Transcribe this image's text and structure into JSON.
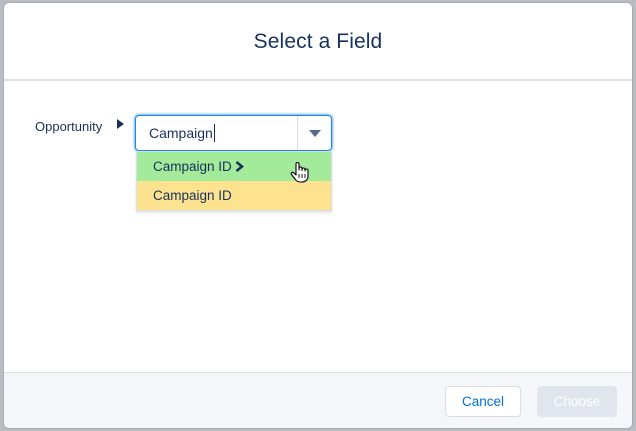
{
  "dialog": {
    "title": "Select a Field"
  },
  "field_path": {
    "object_label": "Opportunity",
    "arrow_icon": "right-triangle-icon"
  },
  "combobox": {
    "value": "Campaign",
    "toggle_icon": "caret-down-icon"
  },
  "dropdown": {
    "options": [
      {
        "label": "Campaign ID",
        "has_children": true,
        "state": "hover",
        "highlight_color": "#a3ea9b",
        "icon": "chevron-right-icon"
      },
      {
        "label": "Campaign ID",
        "has_children": false,
        "state": "highlighted",
        "highlight_color": "#fde38f"
      }
    ]
  },
  "cursor": {
    "icon": "hand-pointer-icon"
  },
  "footer": {
    "cancel_label": "Cancel",
    "choose_label": "Choose",
    "choose_enabled": false
  },
  "colors": {
    "primary_text": "#16325c",
    "link_blue": "#0070d2",
    "focus_border": "#1589ee"
  }
}
